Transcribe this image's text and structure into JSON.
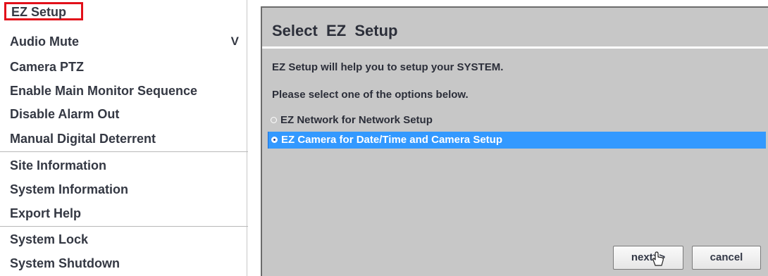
{
  "menu": {
    "items": [
      {
        "label": "EZ Setup"
      },
      {
        "label": "Audio Mute",
        "arrow": "V"
      },
      {
        "label": "Camera PTZ"
      },
      {
        "label": "Enable Main Monitor Sequence"
      },
      {
        "label": "Disable Alarm Out"
      },
      {
        "label": "Manual Digital Deterrent"
      },
      {
        "label": "Site Information"
      },
      {
        "label": "System Information"
      },
      {
        "label": "Export Help"
      },
      {
        "label": "System Lock"
      },
      {
        "label": "System Shutdown"
      }
    ],
    "highlight_color": "#e2101a"
  },
  "dialog": {
    "title": "Select  EZ  Setup",
    "description": "EZ Setup will help you to setup your SYSTEM.",
    "instruction": "Please select one of the options below.",
    "options": [
      {
        "label": "EZ Network for Network Setup",
        "selected": false
      },
      {
        "label": "EZ Camera for Date/Time and Camera Setup",
        "selected": true
      }
    ],
    "next_label": "next>>",
    "cancel_label": "cancel",
    "selection_color": "#3399ff",
    "background_color": "#c7c7c7"
  }
}
